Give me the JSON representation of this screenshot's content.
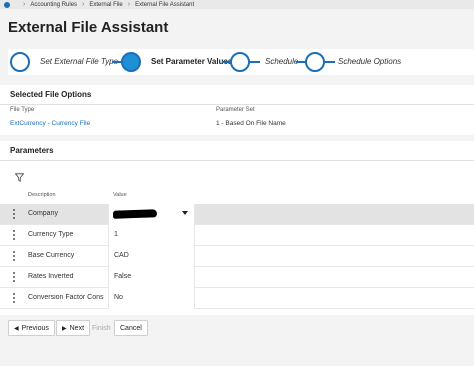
{
  "breadcrumb": {
    "items": [
      "Accounting Rules",
      "External File",
      "External File Assistant"
    ]
  },
  "page": {
    "title": "External File Assistant"
  },
  "wizard": {
    "steps": [
      {
        "label": "Set External File Type",
        "state": "done"
      },
      {
        "label": "Set Parameter Values",
        "state": "active"
      },
      {
        "label": "Schedule",
        "state": "pending"
      },
      {
        "label": "Schedule Options",
        "state": "pending"
      }
    ]
  },
  "selected_file_options": {
    "header": "Selected File Options",
    "file_type_label": "File Type",
    "file_type_value": "ExtCurrency - Currency File",
    "parameter_set_label": "Parameter Set",
    "parameter_set_value": "1 - Based On File Name"
  },
  "parameters": {
    "header": "Parameters",
    "columns": {
      "description": "Description",
      "value": "Value"
    },
    "rows": [
      {
        "description": "Company",
        "value": ""
      },
      {
        "description": "Currency Type",
        "value": "1"
      },
      {
        "description": "Base Currency",
        "value": "CAD"
      },
      {
        "description": "Rates Inverted",
        "value": "False"
      },
      {
        "description": "Conversion Factor Considered",
        "value": "No"
      }
    ]
  },
  "footer": {
    "previous": "Previous",
    "next": "Next",
    "finish": "Finish",
    "cancel": "Cancel"
  },
  "colors": {
    "accent": "#1a6fb8",
    "active_step": "#1f8fd6"
  }
}
